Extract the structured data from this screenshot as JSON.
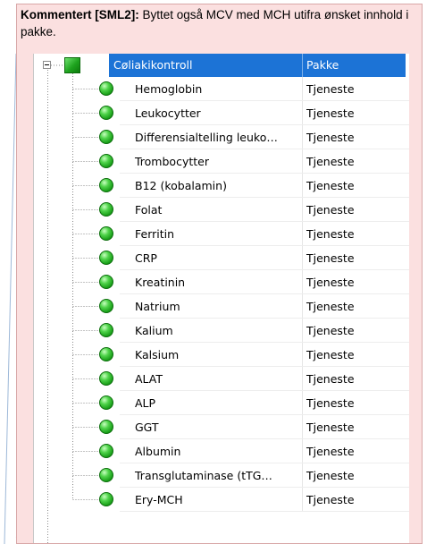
{
  "comment": {
    "author": "Kommentert [SML2]:",
    "text": " Byttet også MCV med MCH utifra ønsket innhold i pakke."
  },
  "tree": {
    "group": {
      "name": "Cøliakikontroll",
      "type": "Pakke",
      "icon": "green-square-icon",
      "expanded": true
    },
    "header_color": "#1c73d6",
    "items": [
      {
        "name": "Hemoglobin",
        "type": "Tjeneste"
      },
      {
        "name": "Leukocytter",
        "type": "Tjeneste"
      },
      {
        "name": "Differensialtelling leuko…",
        "type": "Tjeneste"
      },
      {
        "name": "Trombocytter",
        "type": "Tjeneste"
      },
      {
        "name": "B12 (kobalamin)",
        "type": "Tjeneste"
      },
      {
        "name": "Folat",
        "type": "Tjeneste"
      },
      {
        "name": "Ferritin",
        "type": "Tjeneste"
      },
      {
        "name": "CRP",
        "type": "Tjeneste"
      },
      {
        "name": "Kreatinin",
        "type": "Tjeneste"
      },
      {
        "name": "Natrium",
        "type": "Tjeneste"
      },
      {
        "name": "Kalium",
        "type": "Tjeneste"
      },
      {
        "name": "Kalsium",
        "type": "Tjeneste"
      },
      {
        "name": "ALAT",
        "type": "Tjeneste"
      },
      {
        "name": "ALP",
        "type": "Tjeneste"
      },
      {
        "name": "GGT",
        "type": "Tjeneste"
      },
      {
        "name": "Albumin",
        "type": "Tjeneste"
      },
      {
        "name": "Transglutaminase (tTG…",
        "type": "Tjeneste"
      },
      {
        "name": "Ery-MCH",
        "type": "Tjeneste"
      }
    ]
  }
}
